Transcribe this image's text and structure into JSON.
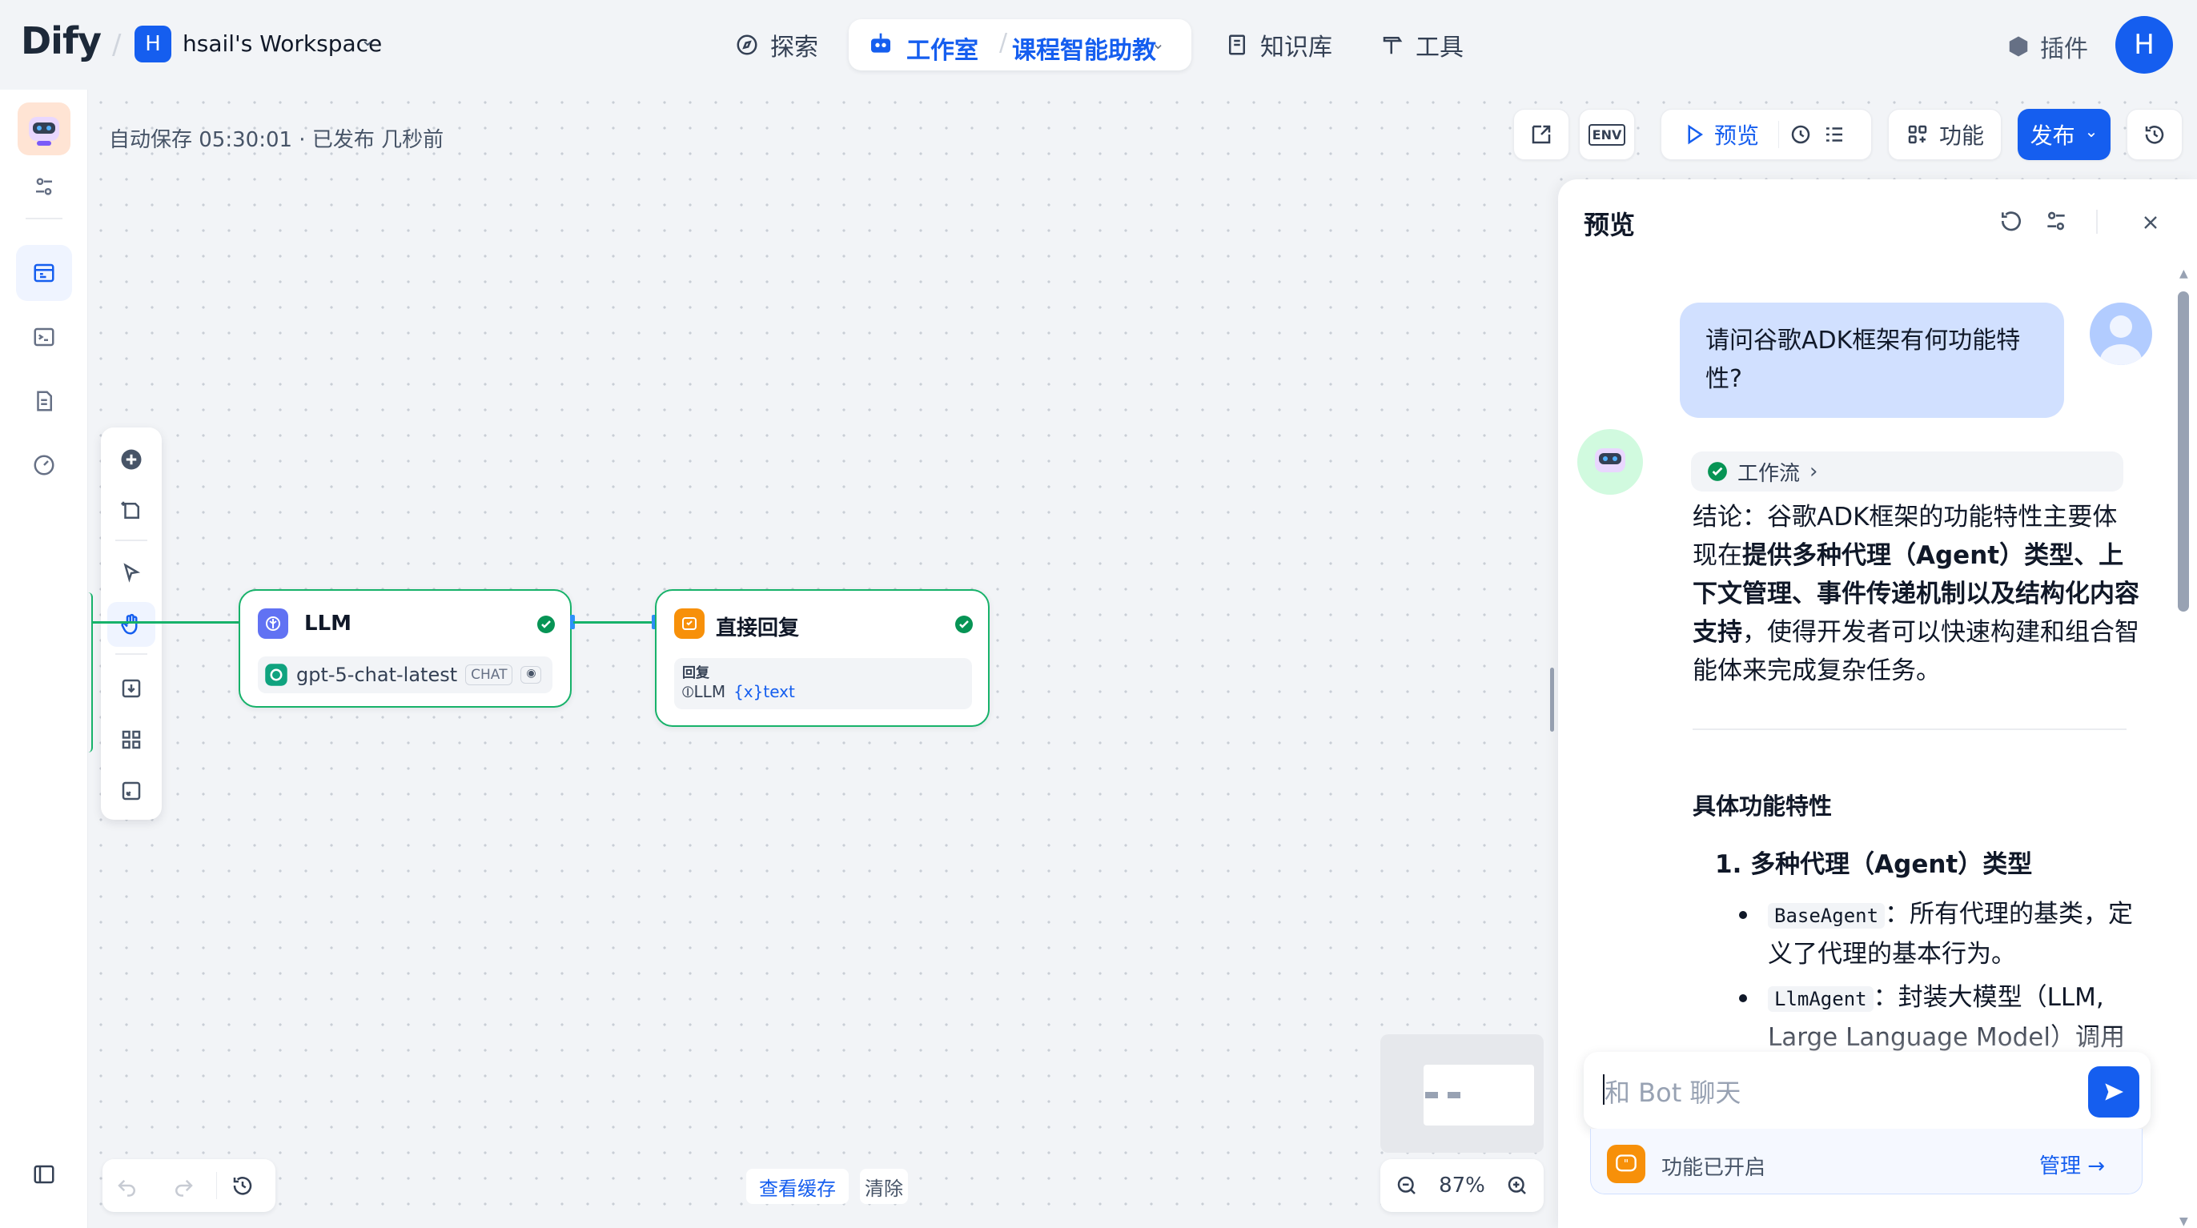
{
  "header": {
    "logo": "Dify",
    "workspace_initial": "H",
    "workspace_name": "hsail's Workspace",
    "nav": {
      "explore": "探索",
      "studio": "工作室",
      "app_name": "课程智能助教",
      "knowledge": "知识库",
      "tools": "工具"
    },
    "plugins": "插件",
    "user_initial": "H"
  },
  "canvas": {
    "autosave": "自动保存 05:30:01 · 已发布 几秒前",
    "toolbar": {
      "env": "ENV",
      "preview": "预览",
      "features": "功能",
      "publish": "发布"
    },
    "nodes": {
      "llm": {
        "title": "LLM",
        "model": "gpt-5-chat-latest",
        "mode_badge": "CHAT"
      },
      "answer": {
        "title": "直接回复",
        "field_label": "回复",
        "var_source": "LLM",
        "var_name": "{x}text"
      }
    },
    "cache": {
      "view": "查看缓存",
      "clear": "清除"
    },
    "zoom": "87%"
  },
  "preview": {
    "title": "预览",
    "user_message": "请问谷歌ADK框架有何功能特性?",
    "workflow_chip": "工作流",
    "answer_p1_a": "结论：谷歌ADK框架的功能特性主要体现在",
    "answer_p1_bold": "提供多种代理（Agent）类型、上下文管理、事件传递机制以及结构化内容支持",
    "answer_p1_b": "，使得开发者可以快速构建和组合智能体来完成复杂任务。",
    "section_title": "具体功能特性",
    "list_item_1": "1. 多种代理（Agent）类型",
    "bullet1_code": "BaseAgent",
    "bullet1_text": "：所有代理的基类，定义了代理的基本行为。",
    "bullet2_code": "LlmAgent",
    "bullet2_text": "：封装大模型（LLM, Large Language Model）调用的代理，可以",
    "input_placeholder": "和 Bot 聊天",
    "features_enabled": "功能已开启",
    "manage": "管理"
  },
  "colors": {
    "primary": "#155eef",
    "success": "#17b26a",
    "warning": "#f79009"
  }
}
